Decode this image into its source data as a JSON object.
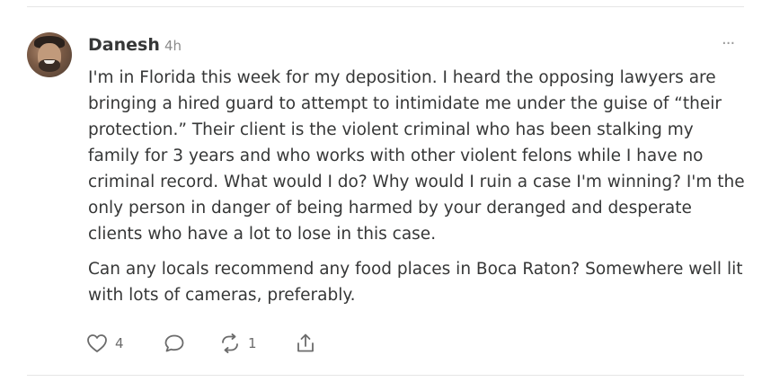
{
  "author": {
    "name": "Danesh",
    "time": "4h"
  },
  "menu": {
    "more_label": "···"
  },
  "post": {
    "paragraphs": [
      "I'm in Florida this week for my deposition. I heard the opposing lawyers are bringing a hired guard to attempt to intimidate me under the guise of “their protection.” Their client is the violent criminal who has been stalking my family for 3 years and who works with other violent felons while I have no criminal record. What would I do? Why would I ruin a case I'm winning? I'm the only person in danger of being harmed by your deranged and desperate clients who have a lot to lose in this case.",
      "Can any locals recommend any food places in Boca Raton? Somewhere well lit with lots of cameras, preferably."
    ]
  },
  "actions": {
    "like": {
      "icon": "heart-icon",
      "count": "4"
    },
    "comment": {
      "icon": "comment-icon"
    },
    "restack": {
      "icon": "restack-icon",
      "count": "1"
    },
    "share": {
      "icon": "share-icon"
    }
  },
  "colors": {
    "text": "#363737",
    "muted": "#8a8a8a",
    "divider": "#e6e6e6"
  }
}
